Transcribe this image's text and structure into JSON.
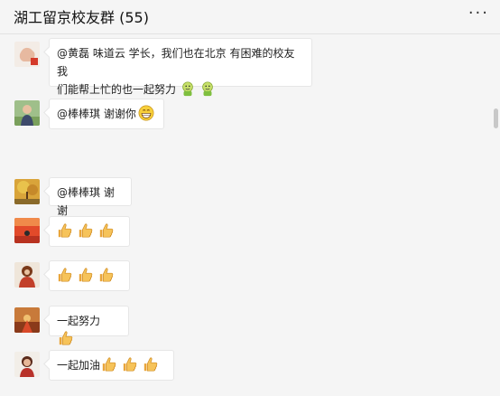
{
  "chat": {
    "title": "湖工留京校友群 (55)",
    "more_icon": "more-dots-icon"
  },
  "messages": [
    {
      "avatar": "avatar-hand-icon",
      "line1": "@黄磊  味道云 学长，我们也在北京 有困难的校友我",
      "line2": "们能帮上忙的也一起努力",
      "emoji": [
        "strong-smiley-emoji",
        "strong-smiley-emoji"
      ]
    },
    {
      "avatar": "avatar-person-icon",
      "text": "@棒棒琪 谢谢你",
      "emoji": [
        "grin-emoji"
      ]
    },
    {
      "avatar": "avatar-autumn-icon",
      "text": "@棒棒琪 谢谢"
    },
    {
      "avatar": "avatar-red-field-icon",
      "text": "",
      "emoji": [
        "thumbs-up-emoji",
        "thumbs-up-emoji",
        "thumbs-up-emoji"
      ]
    },
    {
      "avatar": "avatar-figure-icon",
      "text": "",
      "emoji": [
        "thumbs-up-emoji",
        "thumbs-up-emoji",
        "thumbs-up-emoji"
      ]
    },
    {
      "avatar": "avatar-stage-icon",
      "text": "一起努力",
      "emoji": [
        "thumbs-up-emoji"
      ]
    },
    {
      "avatar": "avatar-portrait-icon",
      "text": "一起加油",
      "emoji": [
        "thumbs-up-emoji",
        "thumbs-up-emoji",
        "thumbs-up-emoji"
      ]
    }
  ],
  "colors": {
    "background": "#f5f5f5",
    "bubble": "#ffffff",
    "thumb": "#f2b84b"
  }
}
